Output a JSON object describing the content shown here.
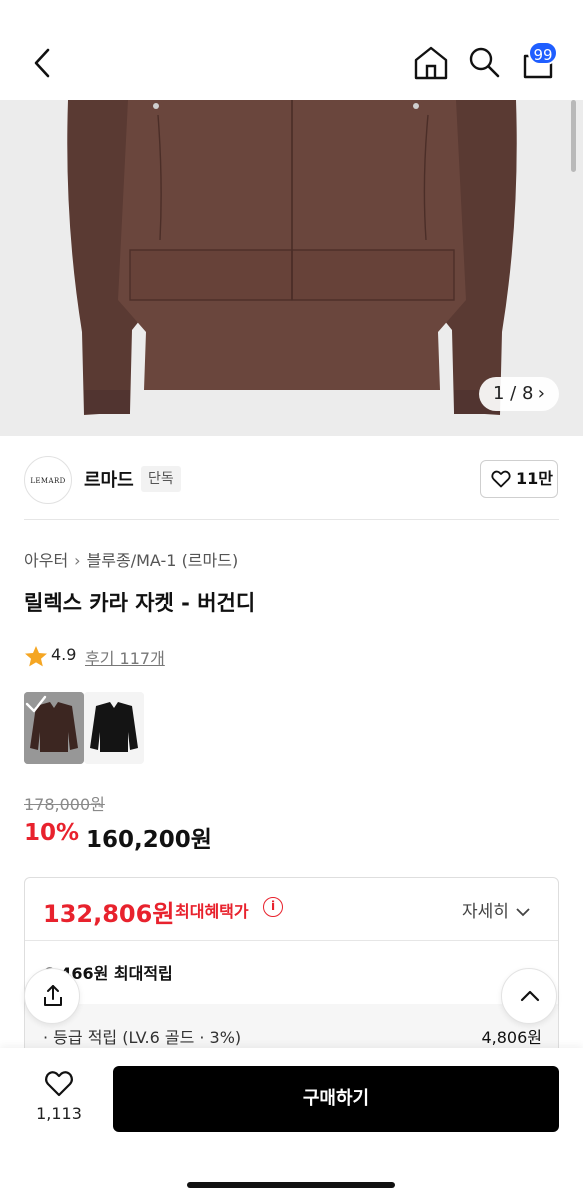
{
  "header": {
    "back_icon": "chevron-left-icon",
    "home_icon": "home-icon",
    "search_icon": "search-icon",
    "cart_icon": "cart-icon",
    "cart_badge": "99"
  },
  "gallery": {
    "counter": "1 / 8",
    "next_icon": "chevron-right-icon"
  },
  "brand": {
    "logo_text": "LEMARD",
    "name": "르마드",
    "tag": "단독",
    "like_count": "11만"
  },
  "product": {
    "breadcrumb": [
      "아우터",
      "블루종/MA-1 (르마드)"
    ],
    "title": "릴렉스 카라 자켓 - 버건디",
    "rating": "4.9",
    "review_link": "후기 117개",
    "original_price": "178,000원",
    "discount_rate": "10%",
    "sale_price": "160,200원"
  },
  "benefit": {
    "best_price": "132,806원",
    "best_price_label": "최대혜택가",
    "info_icon": "i",
    "detail_toggle": "자세히",
    "points_label": "6,466원 최대적립",
    "grade_label": "· 등급 적립 (LV.6 골드 · 3%)",
    "grade_value": "4,806원"
  },
  "bottom": {
    "wish_count": "1,113",
    "buy_label": "구매하기"
  },
  "colors": {
    "accent_red": "#e8222d",
    "badge_blue": "#1f5eff",
    "buy_button": "#000000"
  }
}
